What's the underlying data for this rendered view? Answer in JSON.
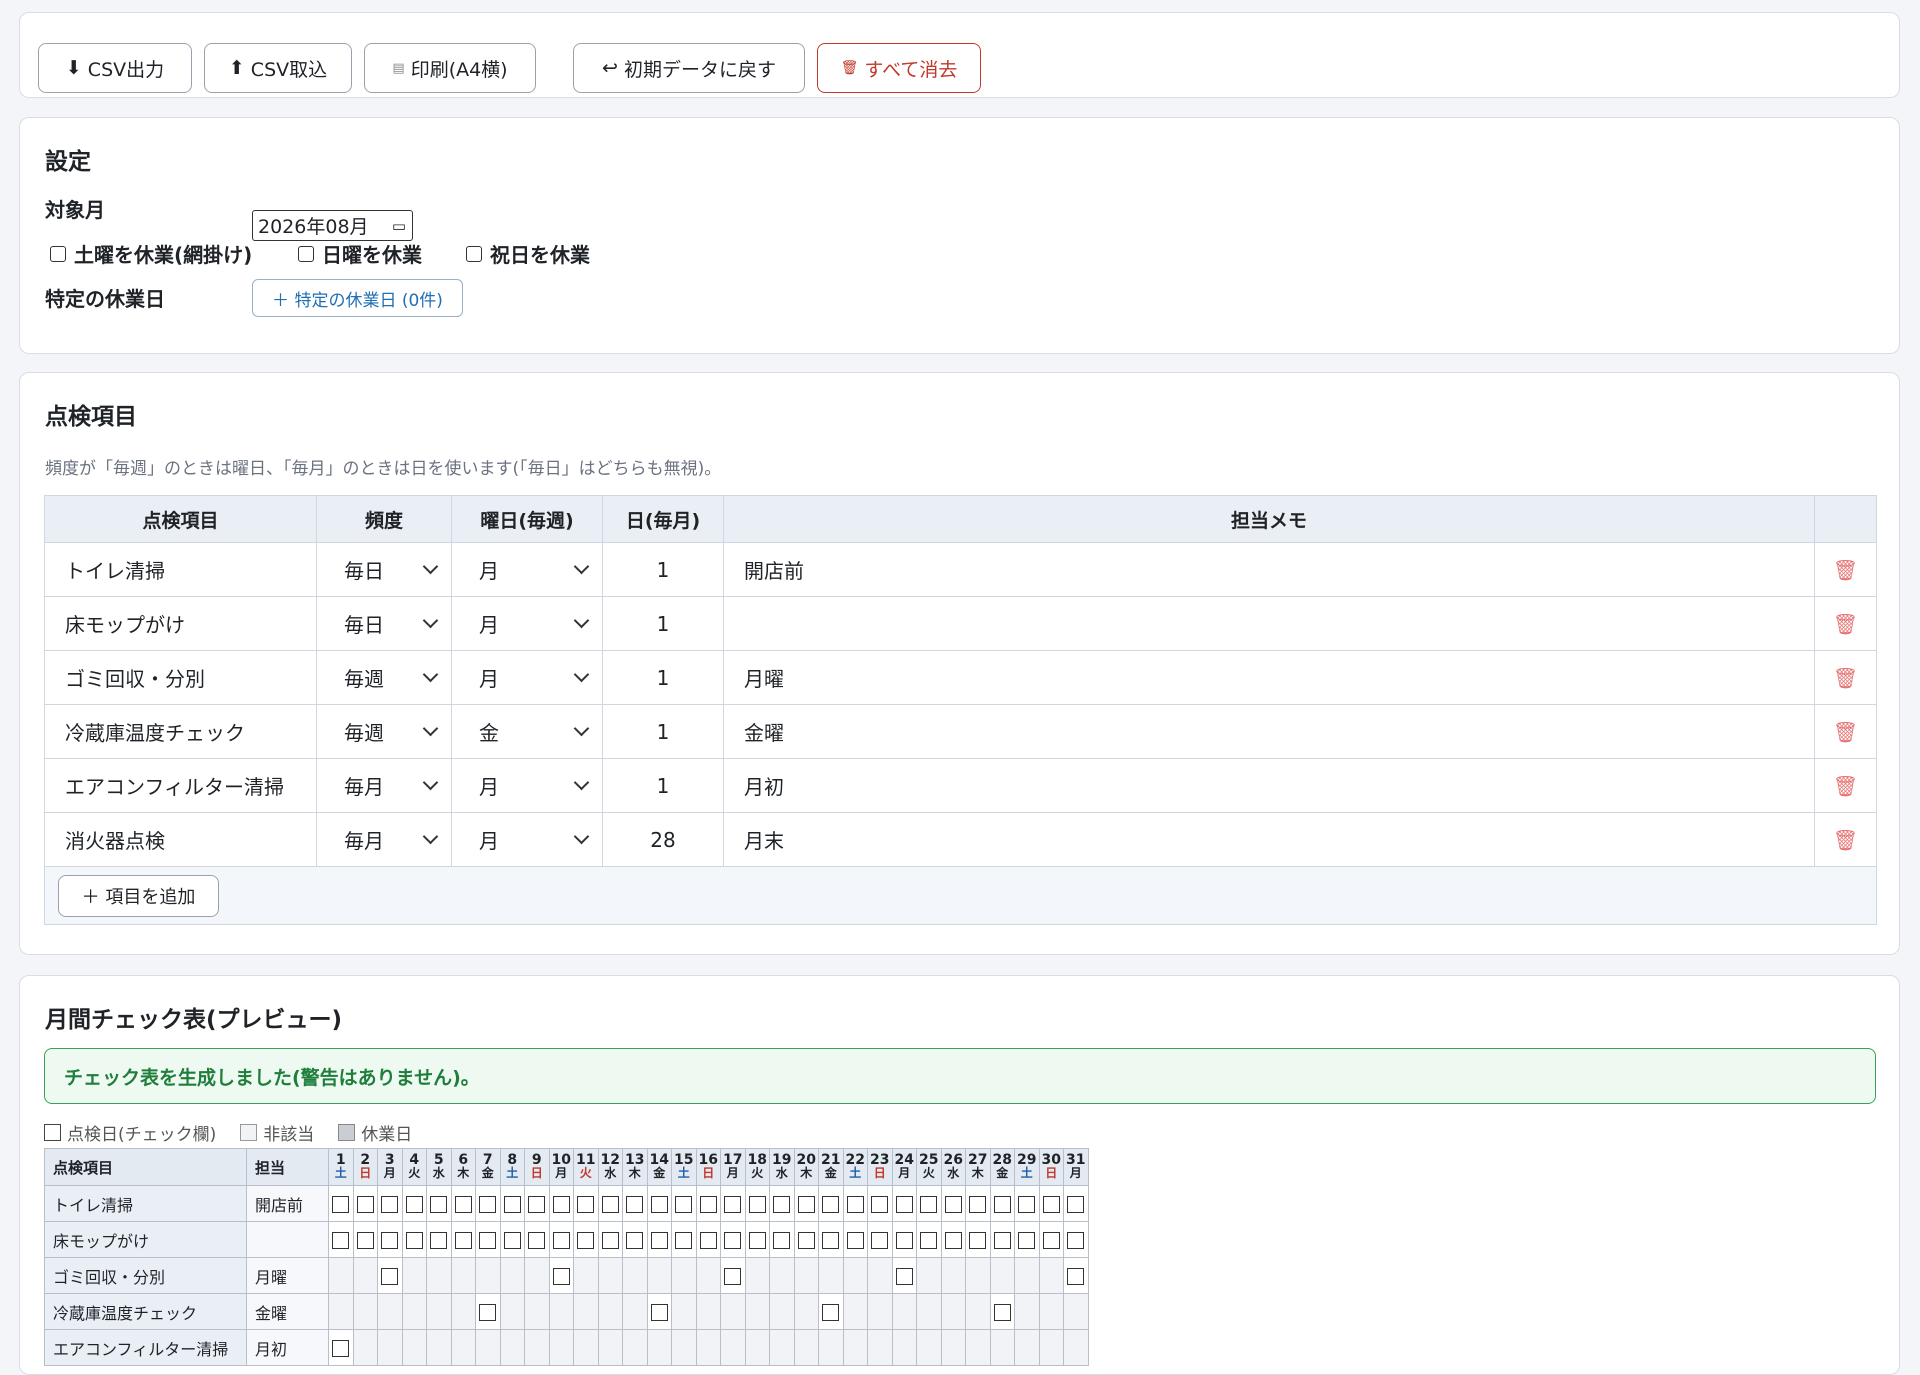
{
  "toolbar": {
    "csv_export": "CSV出力",
    "csv_import": "CSV取込",
    "print": "印刷(A4横)",
    "reset": "初期データに戻す",
    "clear_all": "すべて消去"
  },
  "settings": {
    "title": "設定",
    "month_label": "対象月",
    "month_value": "2026年08月",
    "sat_off": "土曜を休業(網掛け)",
    "sun_off": "日曜を休業",
    "holiday_off": "祝日を休業",
    "specific_label": "特定の休業日",
    "specific_button": "＋ 特定の休業日 (0件)"
  },
  "items": {
    "title": "点検項目",
    "hint": "頻度が「毎週」のときは曜日、「毎月」のときは日を使います(「毎日」はどちらも無視)。",
    "headers": [
      "点検項目",
      "頻度",
      "曜日(毎週)",
      "日(毎月)",
      "担当メモ"
    ],
    "rows": [
      {
        "name": "トイレ清掃",
        "freq": "毎日",
        "weekday": "月",
        "day": "1",
        "memo": "開店前"
      },
      {
        "name": "床モップがけ",
        "freq": "毎日",
        "weekday": "月",
        "day": "1",
        "memo": ""
      },
      {
        "name": "ゴミ回収・分別",
        "freq": "毎週",
        "weekday": "月",
        "day": "1",
        "memo": "月曜"
      },
      {
        "name": "冷蔵庫温度チェック",
        "freq": "毎週",
        "weekday": "金",
        "day": "1",
        "memo": "金曜"
      },
      {
        "name": "エアコンフィルター清掃",
        "freq": "毎月",
        "weekday": "月",
        "day": "1",
        "memo": "月初"
      },
      {
        "name": "消火器点検",
        "freq": "毎月",
        "weekday": "月",
        "day": "28",
        "memo": "月末"
      }
    ],
    "add_button": "＋ 項目を追加"
  },
  "preview": {
    "title": "月間チェック表(プレビュー)",
    "message": "チェック表を生成しました(警告はありません)。",
    "legend": [
      "点検日(チェック欄)",
      "非該当",
      "休業日"
    ],
    "col_item": "点検項目",
    "col_memo": "担当",
    "days": [
      {
        "d": "1",
        "w": "土"
      },
      {
        "d": "2",
        "w": "日"
      },
      {
        "d": "3",
        "w": "月"
      },
      {
        "d": "4",
        "w": "火"
      },
      {
        "d": "5",
        "w": "水"
      },
      {
        "d": "6",
        "w": "木"
      },
      {
        "d": "7",
        "w": "金"
      },
      {
        "d": "8",
        "w": "土"
      },
      {
        "d": "9",
        "w": "日"
      },
      {
        "d": "10",
        "w": "月"
      },
      {
        "d": "11",
        "w": "火"
      },
      {
        "d": "12",
        "w": "水"
      },
      {
        "d": "13",
        "w": "木"
      },
      {
        "d": "14",
        "w": "金"
      },
      {
        "d": "15",
        "w": "土"
      },
      {
        "d": "16",
        "w": "日"
      },
      {
        "d": "17",
        "w": "月"
      },
      {
        "d": "18",
        "w": "火"
      },
      {
        "d": "19",
        "w": "水"
      },
      {
        "d": "20",
        "w": "木"
      },
      {
        "d": "21",
        "w": "金"
      },
      {
        "d": "22",
        "w": "土"
      },
      {
        "d": "23",
        "w": "日"
      },
      {
        "d": "24",
        "w": "月"
      },
      {
        "d": "25",
        "w": "火"
      },
      {
        "d": "26",
        "w": "水"
      },
      {
        "d": "27",
        "w": "木"
      },
      {
        "d": "28",
        "w": "金"
      },
      {
        "d": "29",
        "w": "土"
      },
      {
        "d": "30",
        "w": "日"
      },
      {
        "d": "31",
        "w": "月"
      }
    ],
    "red_days": [
      2,
      9,
      11,
      16,
      23,
      30
    ],
    "blue_days": [
      1,
      8,
      15,
      22,
      29
    ],
    "rows": [
      {
        "name": "トイレ清掃",
        "memo": "開店前",
        "checks": "all"
      },
      {
        "name": "床モップがけ",
        "memo": "",
        "checks": "all"
      },
      {
        "name": "ゴミ回収・分別",
        "memo": "月曜",
        "checks": [
          3,
          10,
          17,
          24,
          31
        ]
      },
      {
        "name": "冷蔵庫温度チェック",
        "memo": "金曜",
        "checks": [
          7,
          14,
          21,
          28
        ]
      },
      {
        "name": "エアコンフィルター清掃",
        "memo": "月初",
        "checks": [
          1
        ]
      }
    ]
  }
}
